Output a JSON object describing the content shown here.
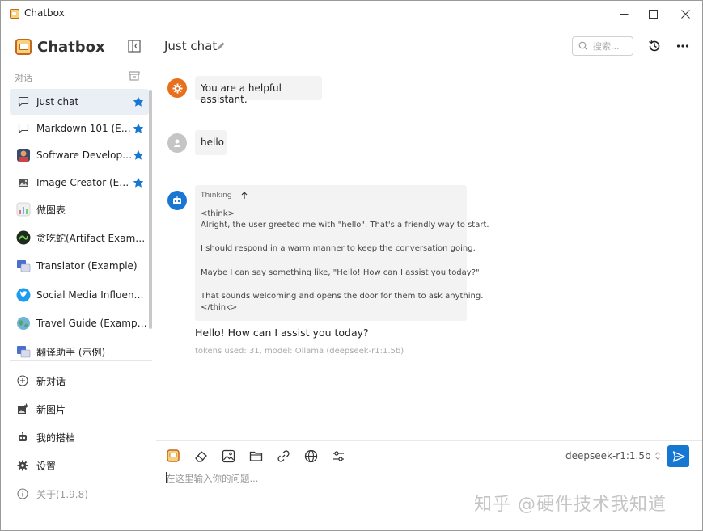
{
  "window": {
    "title": "Chatbox"
  },
  "sidebar": {
    "brand": "Chatbox",
    "section_label": "对话",
    "sessions": [
      {
        "label": "Just chat",
        "starred": true,
        "icon": "chat-bubble-icon"
      },
      {
        "label": "Markdown 101 (E…",
        "starred": true,
        "icon": "chat-bubble-icon"
      },
      {
        "label": "Software Develop…",
        "starred": true,
        "icon": "developer-avatar-icon"
      },
      {
        "label": "Image Creator (E…",
        "starred": true,
        "icon": "image-icon"
      },
      {
        "label": "做图表",
        "starred": false,
        "icon": "chart-avatar-icon"
      },
      {
        "label": "贪吃蛇(Artifact Example)",
        "starred": false,
        "icon": "snake-avatar-icon"
      },
      {
        "label": "Translator (Example)",
        "starred": false,
        "icon": "translator-avatar-icon"
      },
      {
        "label": "Social Media Influence…",
        "starred": false,
        "icon": "twitter-icon"
      },
      {
        "label": "Travel Guide (Example)",
        "starred": false,
        "icon": "globe-avatar-icon"
      },
      {
        "label": "翻译助手 (示例)",
        "starred": false,
        "icon": "translator-avatar-icon"
      }
    ],
    "menu": [
      {
        "label": "新对话",
        "icon": "plus-circle-icon"
      },
      {
        "label": "新图片",
        "icon": "add-image-icon"
      },
      {
        "label": "我的搭档",
        "icon": "robot-icon"
      },
      {
        "label": "设置",
        "icon": "gear-icon"
      },
      {
        "label": "关于(1.9.8)",
        "icon": "info-icon"
      }
    ]
  },
  "header": {
    "title": "Just chat",
    "search_placeholder": "搜索..."
  },
  "messages": {
    "system": "You are a helpful assistant.",
    "user": "hello",
    "thinking_label": "Thinking",
    "thinking_lines": [
      "<think>",
      "Alright, the user greeted me with \"hello\". That's a friendly way to start.",
      "I should respond in a warm manner to keep the conversation going.",
      "Maybe I can say something like, \"Hello! How can I assist you today?\"",
      "That sounds welcoming and opens the door for them to ask anything.",
      "</think>"
    ],
    "reply": "Hello! How can I assist you today?",
    "meta": "tokens used: 31, model: Ollama (deepseek-r1:1.5b)"
  },
  "input": {
    "model": "deepseek-r1:1.5b",
    "placeholder": "在这里输入你的问题..."
  },
  "watermark": "知乎 @硬件技术我知道",
  "colors": {
    "accent": "#1677d2",
    "star": "#1677d2",
    "system_avatar": "#e8701c",
    "user_avatar": "#c5c5c5",
    "assistant_avatar": "#1976d2",
    "active_session": "#eaeff5"
  }
}
